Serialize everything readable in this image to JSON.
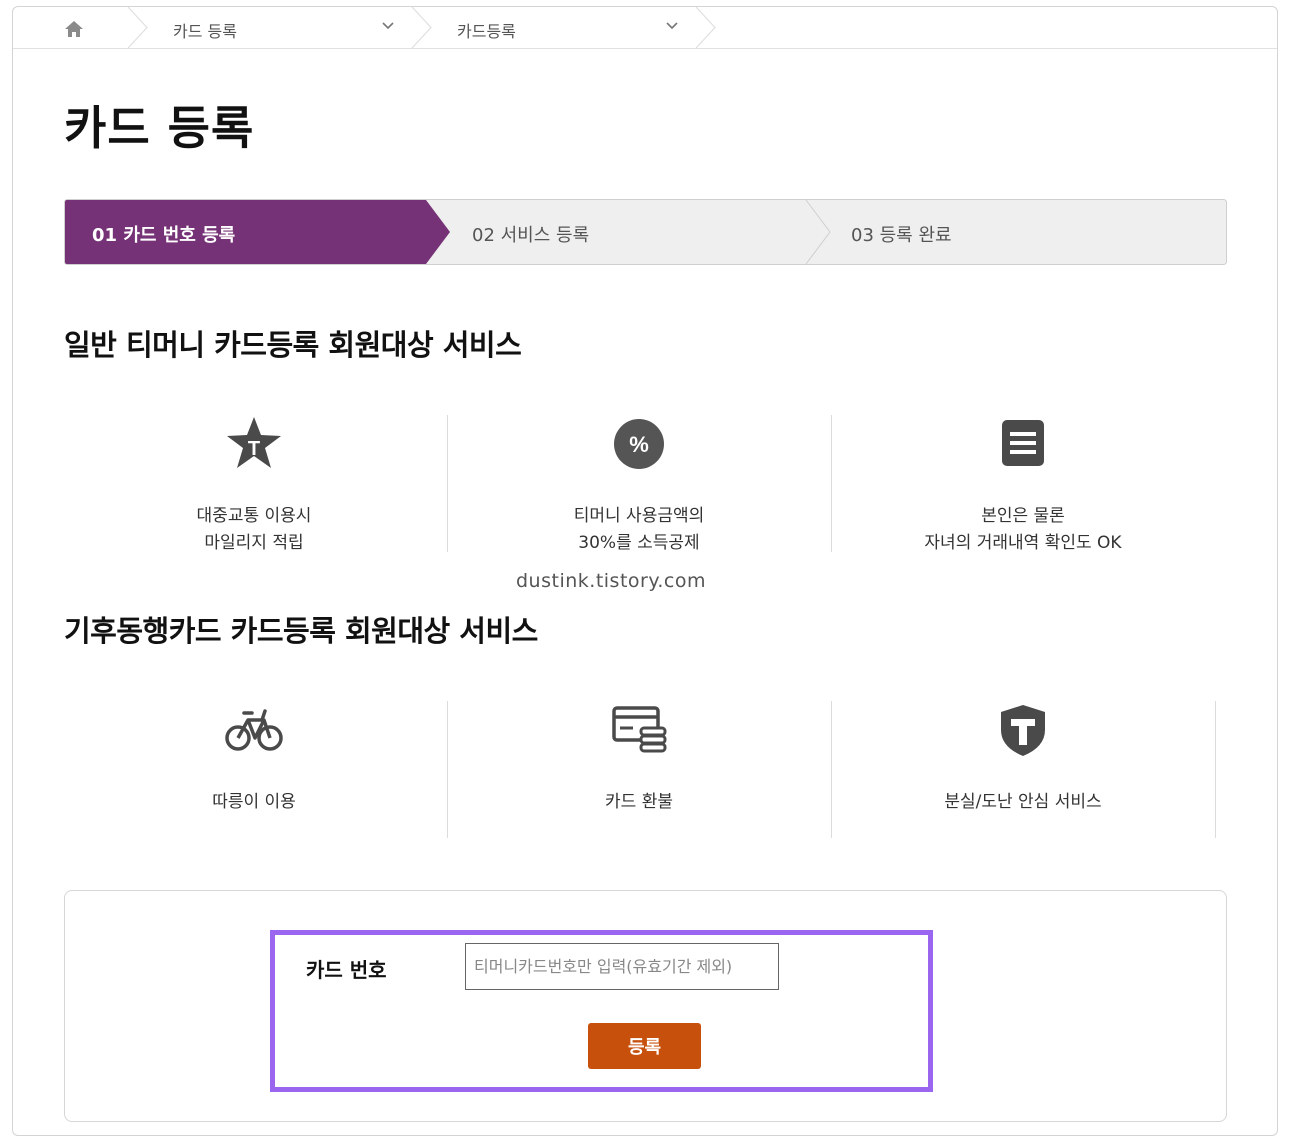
{
  "breadcrumb": {
    "home_icon": "home-icon",
    "items": [
      {
        "label": "카드 등록"
      },
      {
        "label": "카드등록"
      }
    ]
  },
  "page_title": "카드 등록",
  "steps": {
    "active_color": "#763276",
    "inactive_color": "#efefef",
    "items": [
      {
        "label": "01 카드 번호 등록",
        "active": true
      },
      {
        "label": "02 서비스 등록",
        "active": false
      },
      {
        "label": "03 등록 완료",
        "active": false
      }
    ]
  },
  "general_section": {
    "title": "일반 티머니 카드등록 회원대상 서비스",
    "services": [
      {
        "icon": "star-t-icon",
        "line1": "대중교통 이용시",
        "line2": "마일리지 적립"
      },
      {
        "icon": "percent-icon",
        "line1": "티머니 사용금액의",
        "line2": "30%를 소득공제"
      },
      {
        "icon": "document-list-icon",
        "line1": "본인은 물론",
        "line2": "자녀의 거래내역 확인도 OK"
      }
    ]
  },
  "watermark": "dustink.tistory.com",
  "climate_section": {
    "title": "기후동행카드 카드등록 회원대상 서비스",
    "services": [
      {
        "icon": "bicycle-icon",
        "label": "따릉이 이용"
      },
      {
        "icon": "card-coins-icon",
        "label": "카드 환불"
      },
      {
        "icon": "shield-t-icon",
        "label": "분실/도난 안심 서비스"
      }
    ]
  },
  "form": {
    "label": "카드 번호",
    "input_value": "",
    "placeholder": "티머니카드번호만 입력(유효기간 제외)",
    "submit_label": "등록",
    "submit_color": "#c8500d",
    "highlight_color": "#9a66f0"
  }
}
